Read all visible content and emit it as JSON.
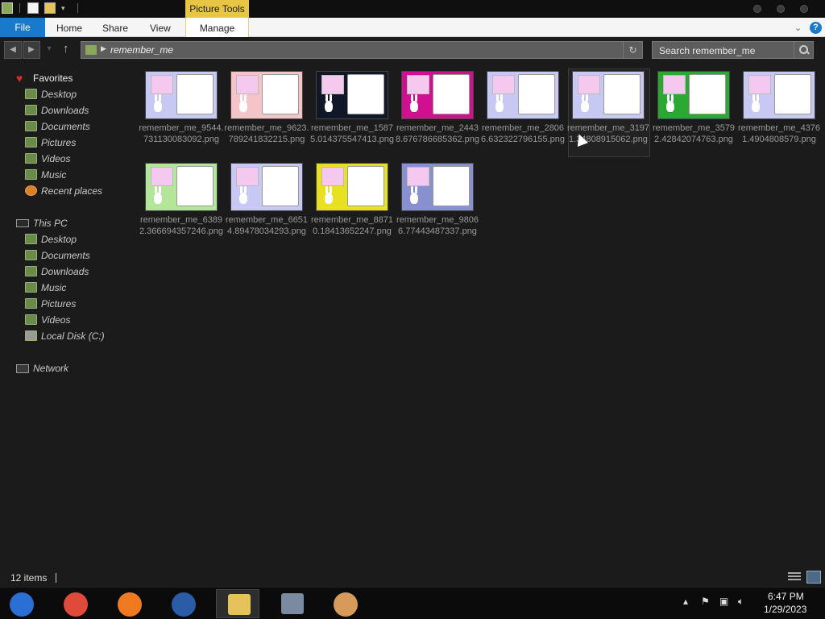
{
  "window": {
    "contextual_tab_group": "Picture Tools"
  },
  "ribbon": {
    "tabs": {
      "file": "File",
      "home": "Home",
      "share": "Share",
      "view": "View",
      "manage": "Manage"
    },
    "help": "?"
  },
  "address_bar": {
    "path": "remember_me",
    "search_placeholder": "Search remember_me"
  },
  "sidebar": {
    "favorites_header": "Favorites",
    "favorites": [
      {
        "label": "Desktop",
        "icon": "desktop-folder-icon"
      },
      {
        "label": "Downloads",
        "icon": "downloads-folder-icon"
      },
      {
        "label": "Documents",
        "icon": "documents-folder-icon"
      },
      {
        "label": "Pictures",
        "icon": "pictures-folder-icon"
      },
      {
        "label": "Videos",
        "icon": "videos-folder-icon"
      },
      {
        "label": "Music",
        "icon": "music-folder-icon"
      },
      {
        "label": "Recent places",
        "icon": "recent-places-icon"
      }
    ],
    "this_pc_header": "This PC",
    "this_pc": [
      {
        "label": "Desktop",
        "icon": "desktop-folder-icon"
      },
      {
        "label": "Documents",
        "icon": "documents-folder-icon"
      },
      {
        "label": "Downloads",
        "icon": "downloads-folder-icon"
      },
      {
        "label": "Music",
        "icon": "music-folder-icon"
      },
      {
        "label": "Pictures",
        "icon": "pictures-folder-icon"
      },
      {
        "label": "Videos",
        "icon": "videos-folder-icon"
      },
      {
        "label": "Local Disk (C:)",
        "icon": "local-disk-icon"
      }
    ],
    "network_header": "Network"
  },
  "files": [
    {
      "name": "remember_me_9544.731130083092.png",
      "bg": "#c8c8f4"
    },
    {
      "name": "remember_me_9623.789241832215.png",
      "bg": "#f4c4c8"
    },
    {
      "name": "remember_me_15875.014375547413.png",
      "bg": "#101828"
    },
    {
      "name": "remember_me_24438.676786685362.png",
      "bg": "#d01090"
    },
    {
      "name": "remember_me_28066.632322796155.png",
      "bg": "#c8c8f4"
    },
    {
      "name": "remember_me_31971.34808915062.png",
      "bg": "#c8c8f4"
    },
    {
      "name": "remember_me_35792.42842074763.png",
      "bg": "#2aa832"
    },
    {
      "name": "remember_me_43761.4904808579.png",
      "bg": "#c8c8f4"
    },
    {
      "name": "remember_me_63892.366694357246.png",
      "bg": "#b4e69a"
    },
    {
      "name": "remember_me_66514.89478034293.png",
      "bg": "#c8c8f4"
    },
    {
      "name": "remember_me_88710.18413652247.png",
      "bg": "#e8e020"
    },
    {
      "name": "remember_me_98066.77443487337.png",
      "bg": "#8890d0"
    }
  ],
  "status": {
    "item_count": "12 items"
  },
  "taskbar": {
    "apps": [
      {
        "name": "chrome-canary-icon",
        "color": "#2a6ed6"
      },
      {
        "name": "chrome-icon",
        "color": "#e04a3a"
      },
      {
        "name": "firefox-icon",
        "color": "#f07a20"
      },
      {
        "name": "obama-logo-icon",
        "color": "#2a5ca8"
      },
      {
        "name": "file-explorer-icon",
        "color": "#e6c35a"
      },
      {
        "name": "system-monitor-icon",
        "color": "#7a8aa0"
      },
      {
        "name": "user-agent-icon",
        "color": "#d89a5a"
      }
    ],
    "clock_time": "6:47 PM",
    "clock_date": "1/29/2023"
  },
  "colors": {
    "accent": "#1979ca",
    "contextual_tab": "#e8c544",
    "background": "#1b1b1b"
  }
}
